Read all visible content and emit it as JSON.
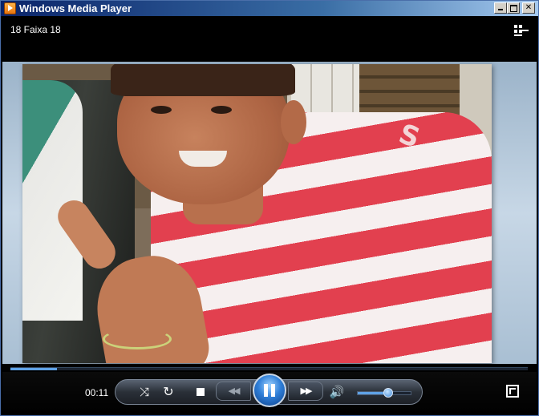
{
  "window": {
    "title": "Windows Media Player",
    "icon": "wmp-app-icon"
  },
  "now_playing": {
    "track_title": "18 Faixa 18"
  },
  "playback": {
    "elapsed": "00:11",
    "seek_progress_fraction": 0.09,
    "volume_fraction": 0.56,
    "state": "playing"
  },
  "controls": {
    "shuffle_icon": "shuffle-icon",
    "repeat_icon": "repeat-icon",
    "stop_icon": "stop-icon",
    "previous_glyph": "◀◀",
    "next_glyph": "▶▶",
    "play_pause_icon": "pause-icon",
    "mute_icon": "speaker-icon",
    "fullscreen_icon": "fullscreen-icon",
    "switch_library_icon": "switch-to-library-icon"
  },
  "colors": {
    "accent": "#2f7fd8",
    "progress": "#5fa2e6"
  }
}
